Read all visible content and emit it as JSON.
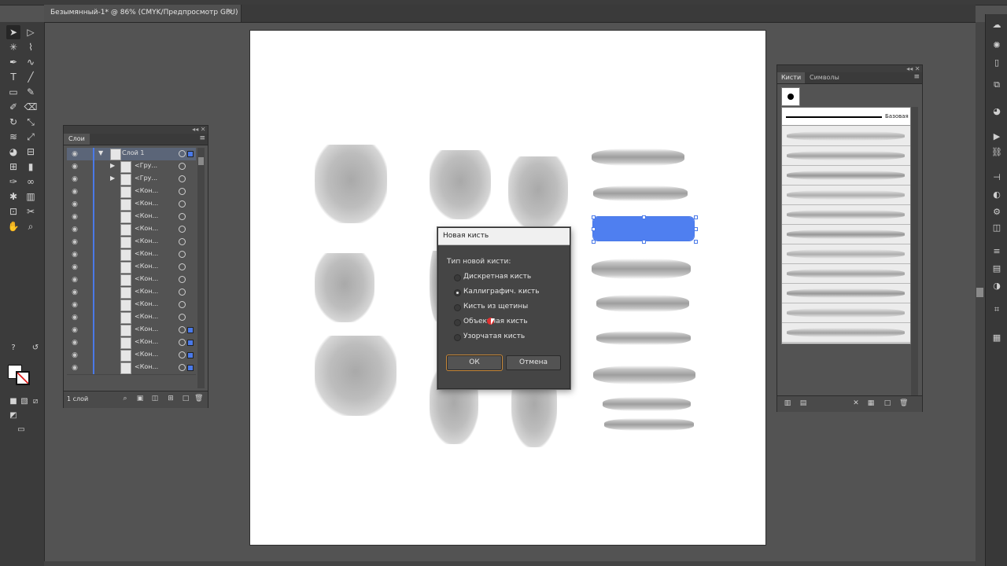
{
  "document": {
    "tab_title": "Безымянный-1* @ 86% (CMYK/Предпросмотр GPU)",
    "close_glyph": "×"
  },
  "toolbar": {
    "tools": [
      "selection-tool",
      "direct-selection-tool",
      "magic-wand-tool",
      "lasso-tool",
      "pen-tool",
      "curvature-tool",
      "type-tool",
      "line-tool",
      "rectangle-tool",
      "paintbrush-tool",
      "shaper-tool",
      "eraser-tool",
      "rotate-tool",
      "scale-tool",
      "width-tool",
      "free-transform-tool",
      "shape-builder-tool",
      "perspective-grid-tool",
      "mesh-tool",
      "gradient-tool",
      "eyedropper-tool",
      "blend-tool",
      "symbol-sprayer-tool",
      "graph-tool",
      "artboard-tool",
      "slice-tool",
      "hand-tool",
      "zoom-tool"
    ]
  },
  "layers_panel": {
    "tab_label": "Слои",
    "footer_count": "1 слой",
    "rows": [
      {
        "name": "Слой 1",
        "expanded": true
      },
      {
        "name": "<Гру...",
        "expanded": false
      },
      {
        "name": "<Гру...",
        "expanded": false
      },
      {
        "name": "<Кон..."
      },
      {
        "name": "<Кон..."
      },
      {
        "name": "<Кон..."
      },
      {
        "name": "<Кон..."
      },
      {
        "name": "<Кон..."
      },
      {
        "name": "<Кон..."
      },
      {
        "name": "<Кон..."
      },
      {
        "name": "<Кон..."
      },
      {
        "name": "<Кон..."
      },
      {
        "name": "<Кон..."
      },
      {
        "name": "<Кон..."
      },
      {
        "name": "<Кон...",
        "selected": true
      },
      {
        "name": "<Кон...",
        "selected": true
      },
      {
        "name": "<Кон...",
        "selected": true
      },
      {
        "name": "<Кон...",
        "selected": true
      }
    ]
  },
  "brushes_panel": {
    "tab_brushes": "Кисти",
    "tab_symbols": "Символы",
    "basic_label": "Базовая",
    "brush_count": 11
  },
  "dialog": {
    "title": "Новая кисть",
    "group_label": "Тип новой кисти:",
    "options": [
      {
        "label": "Дискретная кисть",
        "selected": false
      },
      {
        "label": "Каллиграфич. кисть",
        "selected": true
      },
      {
        "label": "Кисть из щетины",
        "selected": false
      },
      {
        "label": "Объектная кисть",
        "selected": false
      },
      {
        "label": "Узорчатая кисть",
        "selected": false
      }
    ],
    "ok_label": "ОК",
    "cancel_label": "Отмена"
  },
  "colors": {
    "accent": "#4a79e8",
    "selection_fill": "#4f7ff0",
    "ok_outline": "#c8893a"
  }
}
